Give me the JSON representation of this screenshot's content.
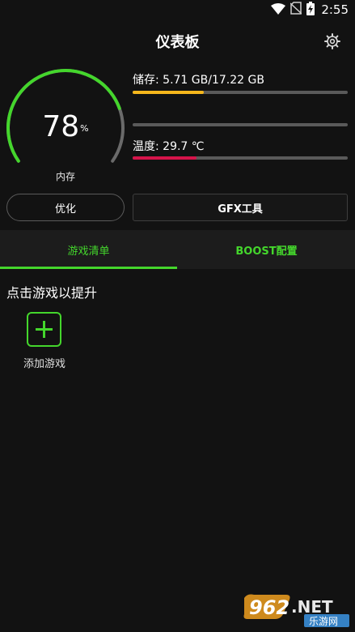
{
  "status_bar": {
    "time": "2:55"
  },
  "header": {
    "title": "仪表板"
  },
  "memory": {
    "value": "78",
    "unit": "%",
    "label": "内存",
    "fraction": 0.78
  },
  "storage": {
    "label": "储存: 5.71 GB/17.22 GB",
    "fraction": 0.3316
  },
  "middle_bar": {
    "fraction": 0
  },
  "temperature": {
    "label": "温度: 29.7 ℃",
    "fraction": 0.297
  },
  "buttons": {
    "optimize": "优化",
    "gfx": "GFX工具"
  },
  "tabs": [
    {
      "label": "游戏清单",
      "active": true
    },
    {
      "label": "BOOST配置",
      "active": false
    }
  ],
  "content": {
    "title": "点击游戏以提升",
    "add_game": "添加游戏"
  },
  "watermark": {
    "brand": "962",
    "suffix": ".NET",
    "subtitle": "乐游网"
  },
  "colors": {
    "accent": "#44d62c",
    "storage_bar": "#f5b71c",
    "temperature_bar": "#d6144a",
    "background": "#121212"
  }
}
